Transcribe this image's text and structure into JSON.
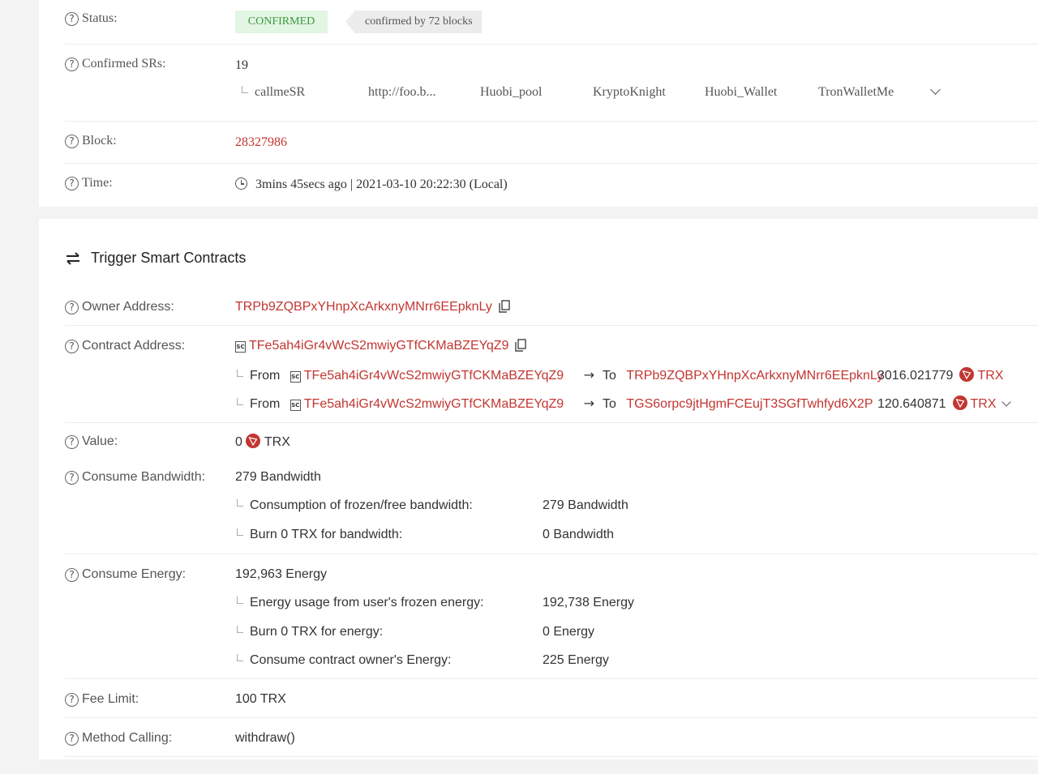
{
  "status": {
    "label": "Status:",
    "badge": "CONFIRMED",
    "blocks": "confirmed by 72 blocks"
  },
  "confirmed_srs": {
    "label": "Confirmed SRs:",
    "count": "19",
    "names": [
      "callmeSR",
      "http://foo.b...",
      "Huobi_pool",
      "KryptoKnight",
      "Huobi_Wallet",
      "TronWalletMe"
    ]
  },
  "block": {
    "label": "Block:",
    "value": "28327986"
  },
  "time": {
    "label": "Time:",
    "value": "3mins 45secs ago | 2021-03-10 20:22:30 (Local)"
  },
  "section": {
    "title": "Trigger Smart Contracts"
  },
  "owner": {
    "label": "Owner Address:",
    "value": "TRPb9ZQBPxYHnpXcArkxnyMNrr6EEpknLy"
  },
  "contract": {
    "label": "Contract Address:",
    "value": "TFe5ah4iGr4vWcS2mwiyGTfCKMaBZEYqZ9",
    "from_label": "From",
    "to_label": "To",
    "transfers": [
      {
        "from": "TFe5ah4iGr4vWcS2mwiyGTfCKMaBZEYqZ9",
        "to": "TRPb9ZQBPxYHnpXcArkxnyMNrr6EEpknLy",
        "amount": "3016.021779",
        "token": "TRX"
      },
      {
        "from": "TFe5ah4iGr4vWcS2mwiyGTfCKMaBZEYqZ9",
        "to": "TGS6orpc9jtHgmFCEujT3SGfTwhfyd6X2P",
        "amount": "120.640871",
        "token": "TRX"
      }
    ]
  },
  "value": {
    "label": "Value:",
    "amount": "0",
    "token": "TRX"
  },
  "bandwidth": {
    "label": "Consume Bandwidth:",
    "total": "279 Bandwidth",
    "rows": [
      {
        "label": "Consumption of frozen/free bandwidth:",
        "value": "279 Bandwidth"
      },
      {
        "label": "Burn 0 TRX for bandwidth:",
        "value": "0 Bandwidth"
      }
    ]
  },
  "energy": {
    "label": "Consume Energy:",
    "total": "192,963 Energy",
    "rows": [
      {
        "label": "Energy usage from user's frozen energy:",
        "value": "192,738 Energy"
      },
      {
        "label": "Burn 0 TRX for energy:",
        "value": "0 Energy"
      },
      {
        "label": "Consume contract owner's Energy:",
        "value": "225 Energy"
      }
    ]
  },
  "fee_limit": {
    "label": "Fee Limit:",
    "value": "100 TRX"
  },
  "method": {
    "label": "Method Calling:",
    "value": "withdraw()"
  },
  "colors": {
    "link": "#c23631",
    "confirmed_bg": "#e3f5e3",
    "confirmed_text": "#3a9b40"
  }
}
